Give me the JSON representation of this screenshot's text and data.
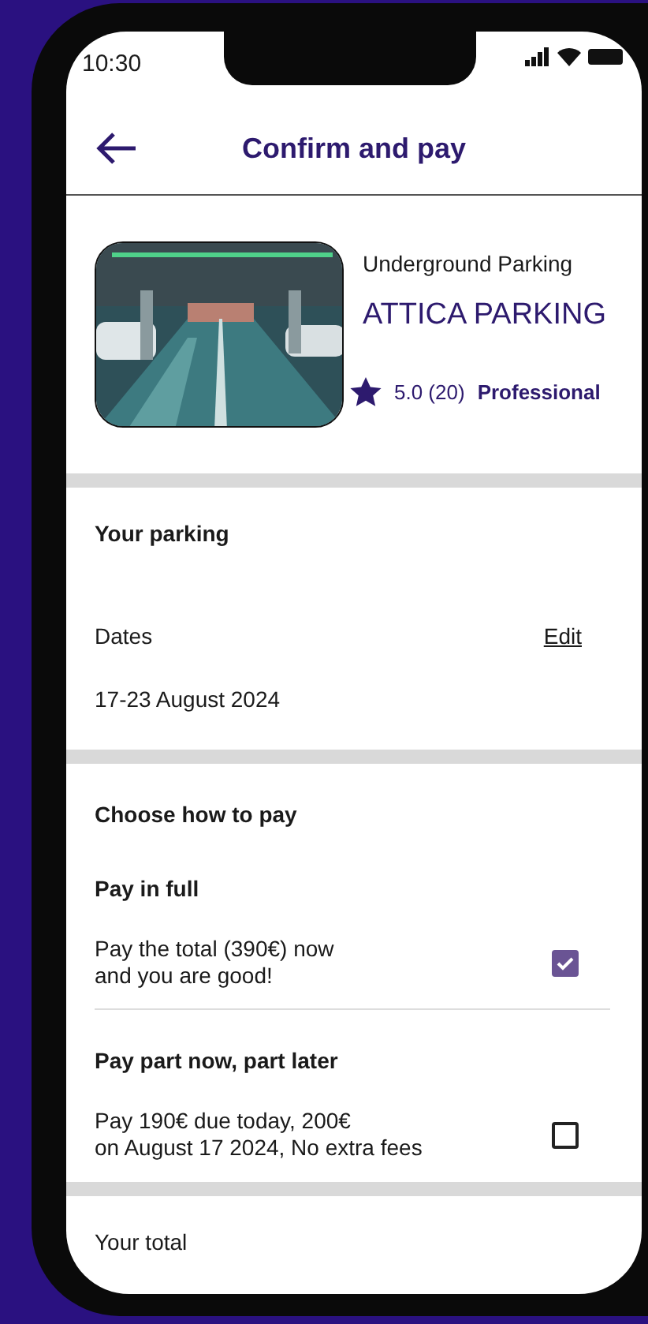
{
  "status_bar": {
    "time": "10:30"
  },
  "header": {
    "title": "Confirm and pay"
  },
  "listing": {
    "category": "Underground Parking",
    "name": "ATTICA PARKING",
    "rating": "5.0 (20)",
    "badge": "Professional"
  },
  "your_parking": {
    "heading": "Your parking",
    "dates_label": "Dates",
    "edit_link": "Edit",
    "dates": "17-23 August 2024"
  },
  "payment": {
    "heading": "Choose how to pay",
    "options": [
      {
        "title": "Pay in full",
        "description": "Pay the total (390€) now\nand you are good!",
        "checked": true
      },
      {
        "title": "Pay part now, part later",
        "description": "Pay 190€ due today, 200€\non August 17 2024, No extra fees",
        "checked": false
      }
    ]
  },
  "total": {
    "label": "Your total"
  }
}
